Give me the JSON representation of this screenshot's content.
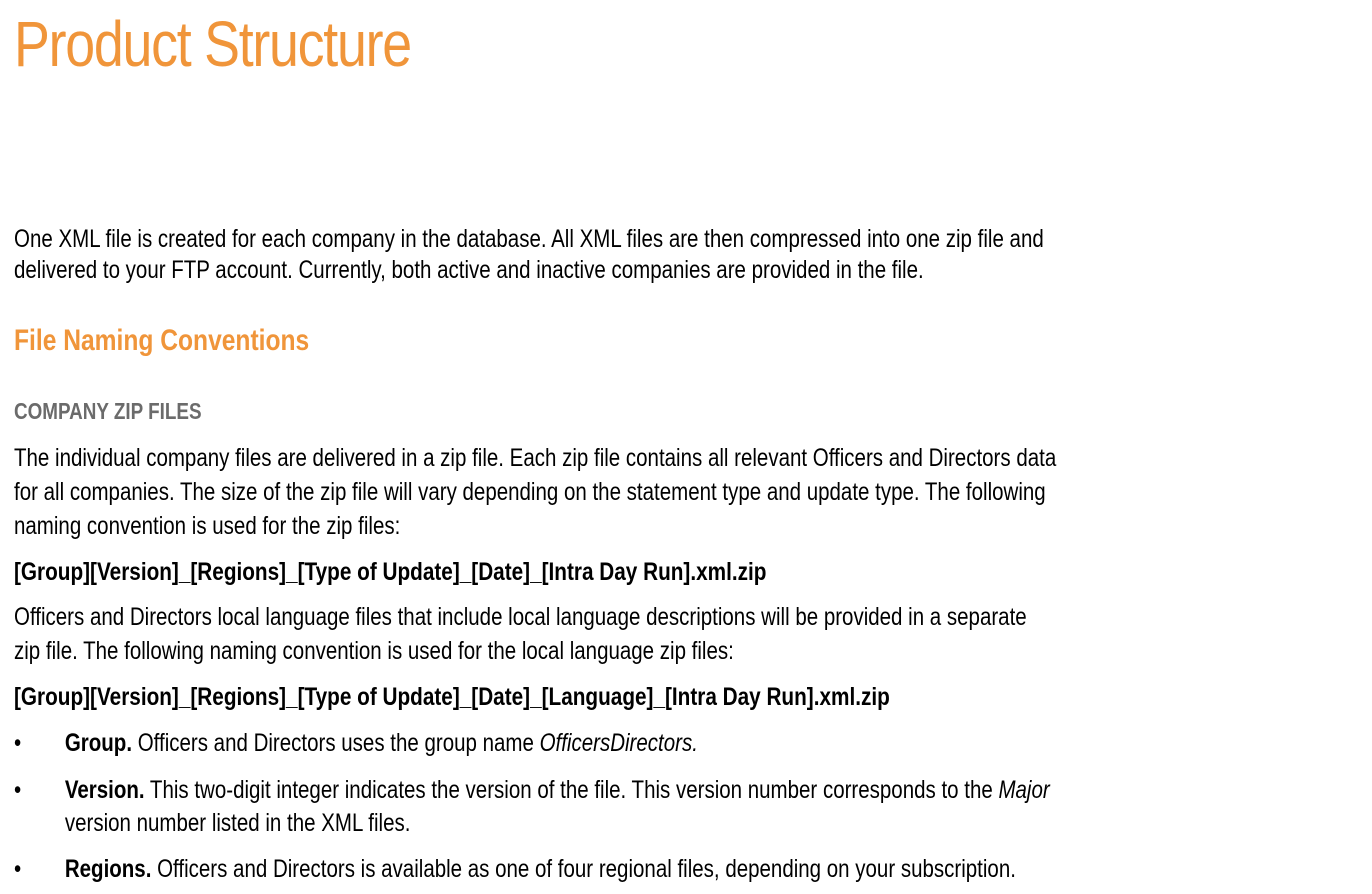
{
  "page": {
    "title": "Product Structure",
    "intro": [
      "One XML file is created for each company in the database. All XML files are then compressed into one zip file and",
      "delivered to your FTP account. Currently, both active and inactive companies are provided in the file."
    ],
    "section": {
      "heading": "File Naming Conventions",
      "subheading": "COMPANY ZIP FILES",
      "para1": [
        "The individual company files are delivered in a zip file. Each zip file contains all relevant Officers and Directors data",
        "for all companies. The size of the zip file will vary depending on the statement type and update type. The following",
        "naming convention is used for the zip files:"
      ],
      "pattern1": "[Group][Version]_[Regions]_[Type of Update]_[Date]_[Intra Day Run].xml.zip",
      "para2": [
        "Officers and Directors local language files that include local language descriptions will be provided in a separate",
        "zip file. The following naming convention is used for the local language zip files:"
      ],
      "pattern2": "[Group][Version]_[Regions]_[Type of Update]_[Date]_[Language]_[Intra Day Run].xml.zip",
      "bullet_symbol": "•",
      "bullets": [
        {
          "term": "Group.",
          "text": " Officers and Directors uses the group name ",
          "emphasis": "OfficersDirectors."
        },
        {
          "term": "Version.",
          "text": " This two-digit integer indicates the version of the file. This version number corresponds to the ",
          "emphasis": "Major",
          "continuation": "version number listed in the XML files."
        },
        {
          "term": "Regions.",
          "text": " Officers and Directors is available as one of four regional files, depending on your subscription."
        }
      ]
    }
  },
  "colors": {
    "accent_orange": "#f0953a",
    "subheading_gray": "#6b6b6b",
    "text": "#000000"
  }
}
